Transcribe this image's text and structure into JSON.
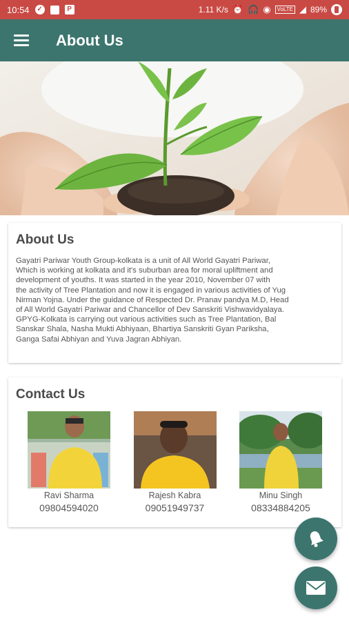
{
  "status_bar": {
    "time": "10:54",
    "network_speed": "1.11 K/s",
    "volte": "VoLTE",
    "battery": "89%"
  },
  "app_bar": {
    "title": "About Us",
    "menu_icon": "hamburger-menu-icon"
  },
  "about": {
    "title": "About Us",
    "lines": [
      "Gayatri Pariwar Youth Group-kolkata is a unit of All World Gayatri Pariwar,",
      "Which is working at kolkata and it's suburban area for moral upliftment and",
      "development of youths. It was started in the year 2010, November 07 with",
      "the activity of Tree Plantation and now it is engaged in various activities of Yug",
      "Nirman Yojna. Under the guidance of Respected Dr. Pranav pandya M.D, Head",
      "of All World Gayatri Pariwar and Chancellor of Dev Sanskriti Vishwavidyalaya.",
      "GPYG-Kolkata is carrying out various activities such as Tree Plantation, Bal",
      "Sanskar Shala, Nasha Mukti Abhiyaan, Bhartiya Sanskriti Gyan Pariksha,",
      "Ganga Safai Abhiyan and Yuva Jagran Abhiyan."
    ]
  },
  "contact": {
    "title": "Contact Us",
    "people": [
      {
        "name": "Ravi Sharma",
        "phone": "09804594020"
      },
      {
        "name": "Rajesh Kabra",
        "phone": "09051949737"
      },
      {
        "name": "Minu Singh",
        "phone": "08334884205"
      }
    ]
  },
  "fabs": {
    "bell_icon": "bell-icon",
    "mail_icon": "mail-icon"
  },
  "colors": {
    "status_bar": "#c94a44",
    "app_bar": "#3c756e",
    "fab": "#3c756e"
  }
}
